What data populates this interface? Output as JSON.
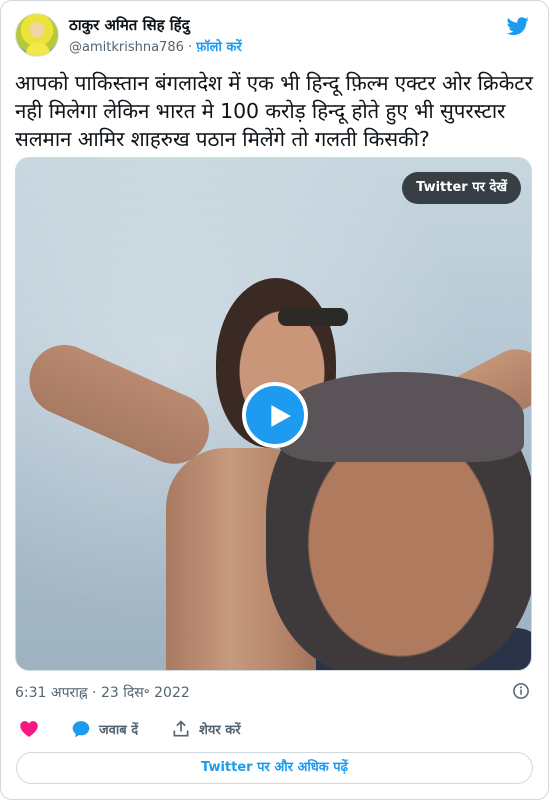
{
  "header": {
    "display_name": "ठाकुर अमित सिह हिंदु",
    "handle": "@amitkrishna786",
    "separator": " · ",
    "follow_label": "फ़ॉलो करें"
  },
  "tweet": {
    "text": "आपको पाकिस्तान बंगलादेश में एक भी हिन्दू फ़िल्म एक्टर ओर क्रिकेटर नही मिलेगा लेकिन भारत मे 100 करोड़ हिन्दू होते हुए भी सुपरस्टार सलमान आमिर शाहरुख पठान मिलेंगे तो गलती किसकी?"
  },
  "media": {
    "view_on_twitter_label": "Twitter पर देखें",
    "play_icon": "play-icon"
  },
  "meta": {
    "timestamp": "6:31 अपराह्न · 23 दिस॰ 2022"
  },
  "actions": {
    "reply_label": "जवाब दें",
    "share_label": "शेयर करें"
  },
  "footer": {
    "read_more_label": "Twitter पर और अधिक पढ़ें"
  },
  "colors": {
    "accent": "#1d9bf0",
    "like": "#f91880",
    "muted_text": "#536471",
    "border": "#cfd9de"
  }
}
